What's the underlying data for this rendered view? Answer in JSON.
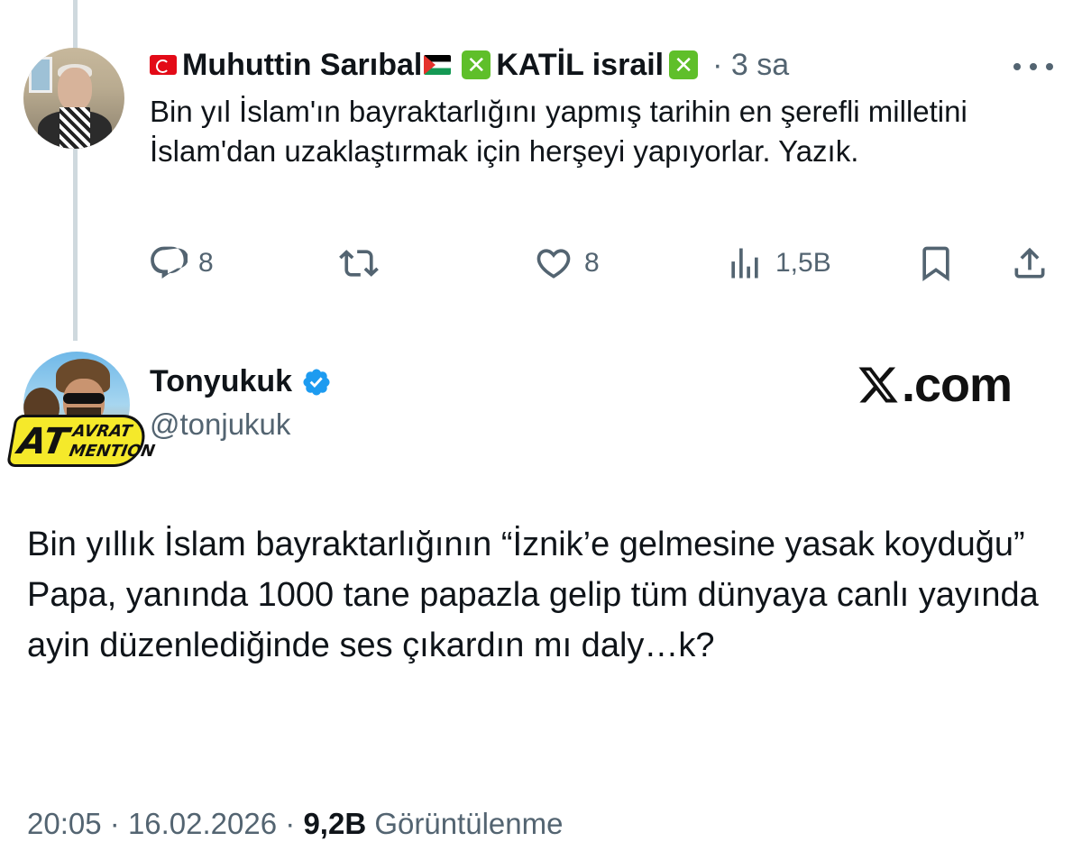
{
  "parent_tweet": {
    "display_name": "Muhuttin Sarıbal",
    "name_suffix": "KATİL israil",
    "x_mark": "✕",
    "time": "· 3 sa",
    "text": "Bin yıl İslam'ın bayraktarlığını yapmış tarihin en şerefli milletini İslam'dan uzaklaştırmak için herşeyi yapıyorlar. Yazık.",
    "replies": "8",
    "likes": "8",
    "views": "1,5B"
  },
  "main_tweet": {
    "display_name": "Tonyukuk",
    "handle": "@tonjukuk",
    "avatar_badge": {
      "big": "AT",
      "line1": "AVRAT",
      "line2": "MENTION"
    },
    "watermark": ".com",
    "text": "Bin yıllık İslam bayraktarlığının “İznik’e gelmesine yasak koyduğu” Papa, yanında 1000 tane papazla gelip tüm dünyaya canlı yayında ayin düzenlediğinde ses çıkardın mı daly…k?",
    "time": "20:05",
    "date": "16.02.2026",
    "views_count": "9,2B",
    "views_label": "Görüntülenme"
  },
  "colors": {
    "muted": "#536471",
    "text": "#0f1419",
    "verified": "#1d9bf0",
    "thread_line": "#cfd9de"
  }
}
